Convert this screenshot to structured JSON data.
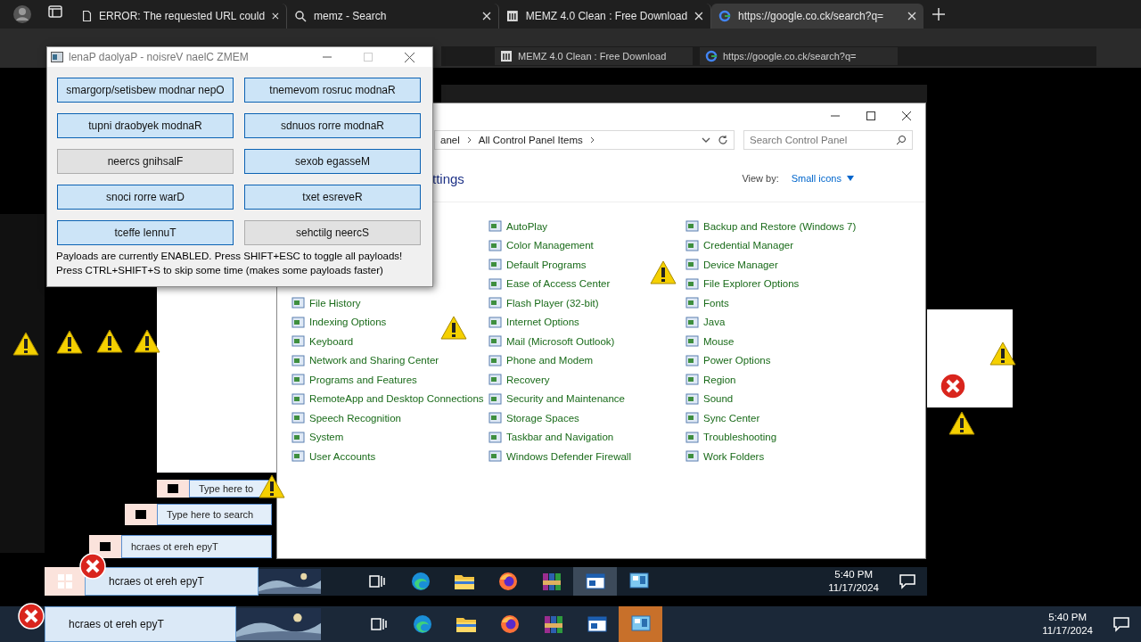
{
  "browser": {
    "tabs": [
      {
        "title": "ERROR: The requested URL could",
        "kind": "page",
        "selected": false
      },
      {
        "title": "memz - Search",
        "kind": "search",
        "selected": false
      },
      {
        "title": "MEMZ 4.0 Clean : Free Download",
        "kind": "archive",
        "selected": false
      },
      {
        "title": "https://google.co.ck/search?q=",
        "kind": "google",
        "selected": true
      }
    ],
    "echo_tabs": [
      {
        "title": "MEMZ 4.0 Clean : Free Download",
        "kind": "archive"
      },
      {
        "title": "https://google.co.ck/search?q=",
        "kind": "google"
      }
    ]
  },
  "memz_panel": {
    "title": "lenaP daolyaP - noisreV naelC ZMEM",
    "buttons": [
      {
        "label": "smargorp/setisbew modnar nepO",
        "on": true
      },
      {
        "label": "tnemevom rosruc modnaR",
        "on": true
      },
      {
        "label": "tupni draobyek modnaR",
        "on": true
      },
      {
        "label": "sdnuos rorre modnaR",
        "on": true
      },
      {
        "label": "neercs gnihsalF",
        "on": false
      },
      {
        "label": "sexob egasseM",
        "on": true
      },
      {
        "label": "snoci rorre warD",
        "on": true
      },
      {
        "label": "txet esreveR",
        "on": true
      },
      {
        "label": "tceffe lennuT",
        "on": true
      },
      {
        "label": "sehctilg neercS",
        "on": false
      }
    ],
    "status": [
      "Payloads are currently ENABLED. Press SHIFT+ESC to toggle all payloads!",
      "Press CTRL+SHIFT+S to skip some time (makes some payloads faster)"
    ]
  },
  "control_panel": {
    "breadcrumb": [
      "anel",
      "All Control Panel Items"
    ],
    "search": {
      "placeholder": "Search Control Panel"
    },
    "heading": "ttings",
    "view_by": {
      "label": "View by:",
      "value": "Small icons"
    },
    "columns": [
      [
        "File History",
        "Indexing Options",
        "Keyboard",
        "Network and Sharing Center",
        "Programs and Features",
        "RemoteApp and Desktop Connections",
        "Speech Recognition",
        "System",
        "User Accounts"
      ],
      [
        "AutoPlay",
        "Color Management",
        "Default Programs",
        "Ease of Access Center",
        "Flash Player (32-bit)",
        "Internet Options",
        "Mail (Microsoft Outlook)",
        "Phone and Modem",
        "Recovery",
        "Security and Maintenance",
        "Storage Spaces",
        "Taskbar and Navigation",
        "Windows Defender Firewall"
      ],
      [
        "Backup and Restore (Windows 7)",
        "Credential Manager",
        "Device Manager",
        "File Explorer Options",
        "Fonts",
        "Java",
        "Mouse",
        "Power Options",
        "Region",
        "Sound",
        "Sync Center",
        "Troubleshooting",
        "Work Folders"
      ]
    ]
  },
  "glitch_search_bars": [
    "Type here to",
    "Type here to search",
    "hcraes ot ereh epyT"
  ],
  "taskbars": [
    {
      "search": "hcraes ot ereh epyT",
      "time": "5:40 PM",
      "date": "11/17/2024",
      "apps": [
        {
          "kind": "taskview",
          "active": false
        },
        {
          "kind": "edge",
          "active": false
        },
        {
          "kind": "folder",
          "active": false
        },
        {
          "kind": "firefox",
          "active": false
        },
        {
          "kind": "winrar",
          "active": false
        },
        {
          "kind": "window",
          "active": true
        },
        {
          "kind": "panel",
          "active": false
        }
      ]
    },
    {
      "search": "hcraes ot ereh epyT",
      "time": "5:40 PM",
      "date": "11/17/2024",
      "apps": [
        {
          "kind": "taskview",
          "active": false
        },
        {
          "kind": "edge",
          "active": false
        },
        {
          "kind": "folder",
          "active": false
        },
        {
          "kind": "firefox",
          "active": false
        },
        {
          "kind": "winrar",
          "active": false
        },
        {
          "kind": "window",
          "active": false
        },
        {
          "kind": "panel",
          "active": true
        }
      ]
    }
  ]
}
